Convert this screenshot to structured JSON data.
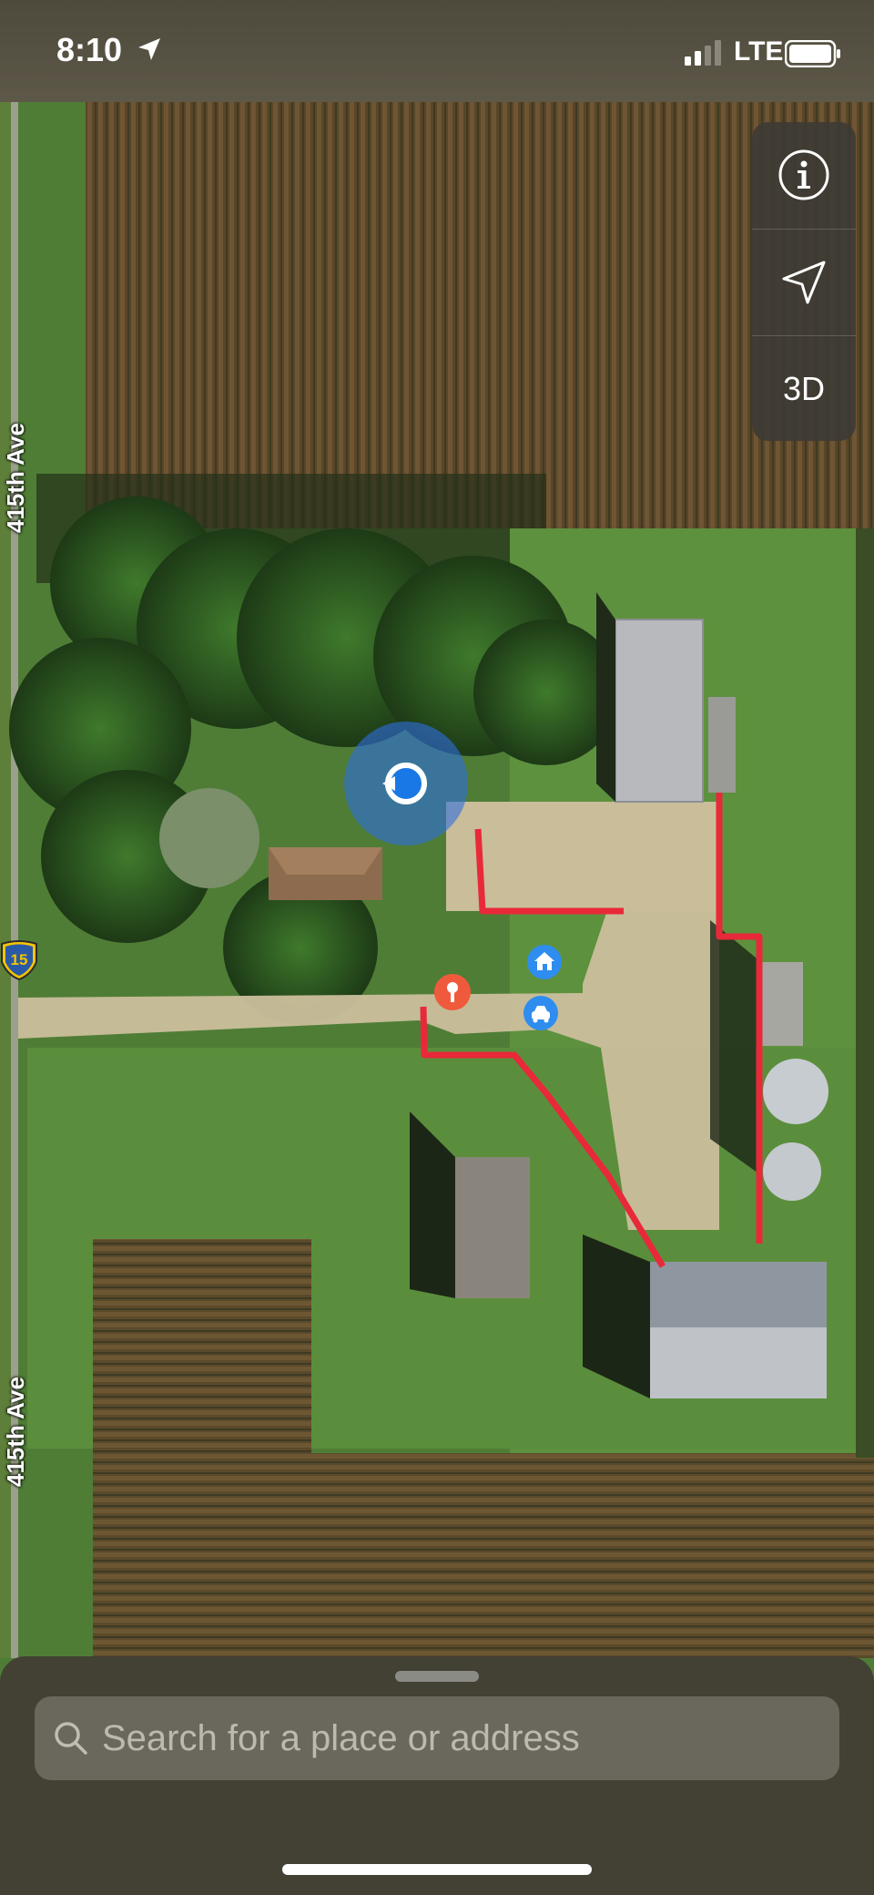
{
  "status_bar": {
    "time": "8:10",
    "carrier": "LTE"
  },
  "map_controls": {
    "info_icon": "info-icon",
    "location_icon": "location-arrow-icon",
    "view_3d_label": "3D"
  },
  "road_labels": {
    "top": "415th Ave",
    "bottom": "415th Ave",
    "route_shield": "15"
  },
  "search": {
    "placeholder": "Search for a place or address"
  },
  "colors": {
    "route_line": "#e8293a",
    "user_location": "#1a78e6",
    "pin_red": "#f05a3c",
    "poi_blue": "#2f8df0"
  }
}
